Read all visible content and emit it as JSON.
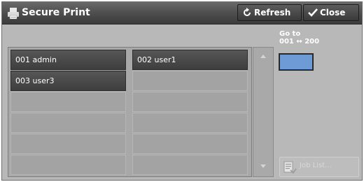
{
  "header": {
    "title": "Secure Print",
    "title_icon": "printer-icon",
    "refresh_label": "Refresh",
    "refresh_icon": "refresh-icon",
    "close_label": "Close",
    "close_icon": "checkmark-icon"
  },
  "users": [
    {
      "label": "001  admin"
    },
    {
      "label": "002  user1"
    },
    {
      "label": "003  user3"
    }
  ],
  "goto": {
    "line1": "Go to",
    "line2": "001 ↔ 200",
    "value": ""
  },
  "job_list": {
    "label": "Job List...",
    "icon": "job-list-icon"
  },
  "colors": {
    "accent": "#6e9ad6",
    "header_bg": "#4e4e4e",
    "panel_bg": "#b8b8b8"
  }
}
